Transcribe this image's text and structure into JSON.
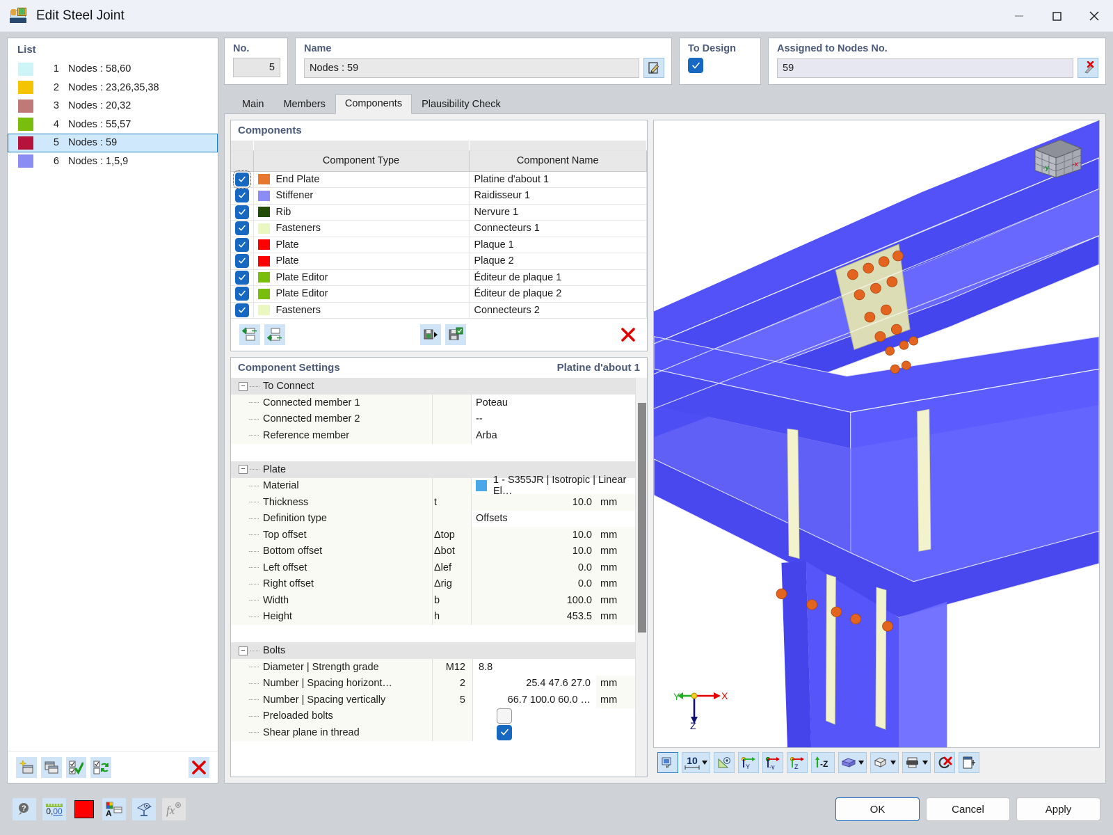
{
  "window": {
    "title": "Edit Steel Joint",
    "icon": "steel-joint-icon",
    "minimize": "minimize-icon",
    "maximize": "maximize-icon",
    "close": "close-icon"
  },
  "list_panel": {
    "title": "List",
    "items": [
      {
        "index": "1",
        "label": "Nodes : 58,60",
        "color": "#cdf4f7"
      },
      {
        "index": "2",
        "label": "Nodes : 23,26,35,38",
        "color": "#f5c400"
      },
      {
        "index": "3",
        "label": "Nodes : 20,32",
        "color": "#c07878"
      },
      {
        "index": "4",
        "label": "Nodes : 55,57",
        "color": "#79bd0d"
      },
      {
        "index": "5",
        "label": "Nodes : 59",
        "color": "#b5123c",
        "selected": true
      },
      {
        "index": "6",
        "label": "Nodes : 1,5,9",
        "color": "#8c8cf5"
      }
    ],
    "toolbar": [
      {
        "name": "new-item-button",
        "icon": "new-window-icon"
      },
      {
        "name": "copy-item-button",
        "icon": "copy-window-icon"
      },
      {
        "name": "select-all-button",
        "icon": "check-all-icon"
      },
      {
        "name": "invert-selection-button",
        "icon": "invert-check-icon"
      },
      {
        "name": "delete-item-button",
        "icon": "red-x-icon"
      }
    ]
  },
  "header": {
    "no": {
      "label": "No.",
      "value": "5"
    },
    "name": {
      "label": "Name",
      "value": "Nodes : 59",
      "edit_icon": "pencil-edit-icon"
    },
    "to_design": {
      "label": "To Design",
      "checked": true
    },
    "assigned": {
      "label": "Assigned to Nodes No.",
      "value": "59",
      "pick_icon": "pick-delete-icon"
    }
  },
  "tabs": [
    {
      "label": "Main",
      "active": false
    },
    {
      "label": "Members",
      "active": false
    },
    {
      "label": "Components",
      "active": true
    },
    {
      "label": "Plausibility Check",
      "active": false
    }
  ],
  "components_panel": {
    "title": "Components",
    "columns": [
      "Component Type",
      "Component Name"
    ],
    "rows": [
      {
        "checked": true,
        "focused": true,
        "color": "#e8762c",
        "type": "End Plate",
        "name": "Platine d'about 1"
      },
      {
        "checked": true,
        "color": "#8c8cf5",
        "type": "Stiffener",
        "name": "Raidisseur 1"
      },
      {
        "checked": true,
        "color": "#234d07",
        "type": "Rib",
        "name": "Nervure 1"
      },
      {
        "checked": true,
        "color": "#eaf7c0",
        "type": "Fasteners",
        "name": "Connecteurs 1"
      },
      {
        "checked": true,
        "color": "#fe0000",
        "type": "Plate",
        "name": "Plaque 1"
      },
      {
        "checked": true,
        "color": "#fe0000",
        "type": "Plate",
        "name": "Plaque 2"
      },
      {
        "checked": true,
        "color": "#79bd0d",
        "type": "Plate Editor",
        "name": "Éditeur de plaque 1"
      },
      {
        "checked": true,
        "color": "#79bd0d",
        "type": "Plate Editor",
        "name": "Éditeur de plaque 2"
      },
      {
        "checked": true,
        "color": "#eaf7c0",
        "type": "Fasteners",
        "name": "Connecteurs 2"
      }
    ],
    "toolbar": [
      {
        "name": "move-component-up-button",
        "icon": "insert-before-icon"
      },
      {
        "name": "move-component-down-button",
        "icon": "insert-after-icon"
      },
      {
        "name": "import-component-button",
        "icon": "import-green-icon"
      },
      {
        "name": "save-component-button",
        "icon": "save-green-icon"
      },
      {
        "name": "delete-component-button",
        "icon": "red-x-icon"
      }
    ]
  },
  "settings_panel": {
    "title": "Component Settings",
    "subject": "Platine d'about 1",
    "groups": [
      {
        "name": "To Connect",
        "expanded": true,
        "rows": [
          {
            "label": "Connected member 1",
            "symbol": "",
            "value": "Poteau",
            "unit": ""
          },
          {
            "label": "Connected member 2",
            "symbol": "",
            "value": "--",
            "unit": ""
          },
          {
            "label": "Reference member",
            "symbol": "",
            "value": "Arba",
            "unit": ""
          }
        ]
      },
      {
        "name": "Plate",
        "expanded": true,
        "rows": [
          {
            "label": "Material",
            "symbol": "",
            "value": "1 - S355JR | Isotropic | Linear El…",
            "unit": "",
            "swatch": "#4aa8e8"
          },
          {
            "label": "Thickness",
            "symbol": "t",
            "value": "10.0",
            "unit": "mm",
            "numeric": true
          },
          {
            "label": "Definition type",
            "symbol": "",
            "value": "Offsets",
            "unit": ""
          },
          {
            "label": "Top offset",
            "symbol": "Δtop",
            "value": "10.0",
            "unit": "mm",
            "numeric": true
          },
          {
            "label": "Bottom offset",
            "symbol": "Δbot",
            "value": "10.0",
            "unit": "mm",
            "numeric": true
          },
          {
            "label": "Left offset",
            "symbol": "Δlef",
            "value": "0.0",
            "unit": "mm",
            "numeric": true
          },
          {
            "label": "Right offset",
            "symbol": "Δrig",
            "value": "0.0",
            "unit": "mm",
            "numeric": true
          },
          {
            "label": "Width",
            "symbol": "b",
            "value": "100.0",
            "unit": "mm",
            "numeric": true
          },
          {
            "label": "Height",
            "symbol": "h",
            "value": "453.5",
            "unit": "mm",
            "numeric": true
          }
        ]
      },
      {
        "name": "Bolts",
        "expanded": true,
        "rows": [
          {
            "label": "Diameter | Strength grade",
            "col1": "M12",
            "value": "8.8",
            "unit": "",
            "leftalign": true
          },
          {
            "label": "Number | Spacing horizont…",
            "col1": "2",
            "value": "25.4 47.6 27.0",
            "unit": "mm"
          },
          {
            "label": "Number | Spacing vertically",
            "col1": "5",
            "value": "66.7 100.0 60.0 …",
            "unit": "mm"
          },
          {
            "label": "Preloaded bolts",
            "checkbox": false
          },
          {
            "label": "Shear plane in thread",
            "checkbox": true
          }
        ]
      }
    ]
  },
  "viewport": {
    "axis": {
      "x": "X",
      "y": "Y",
      "z": "Z"
    },
    "cube": {
      "face_left": "-y",
      "face_right": "-x"
    },
    "toolbar": [
      {
        "name": "render-mode-button",
        "icon": "render-image-icon",
        "selected": true
      },
      {
        "name": "zoom-factor-select",
        "icon": "ruler-icon",
        "value": "10",
        "dropdown": true
      },
      {
        "name": "measure-button",
        "icon": "measure-angle-icon"
      },
      {
        "name": "view-in-y-button",
        "icon": "axis-y-icon",
        "label": "Y"
      },
      {
        "name": "view-in-minus-y-button",
        "icon": "axis-minus-y-icon",
        "label": "-Y"
      },
      {
        "name": "view-in-z-button",
        "icon": "axis-z-icon",
        "label": "Z"
      },
      {
        "name": "view-in-minus-z-button",
        "icon": "axis-minus-z-icon",
        "label": "-Z"
      },
      {
        "name": "display-style-button",
        "icon": "solid-block-icon",
        "dropdown": true
      },
      {
        "name": "view-box-button",
        "icon": "wireframe-cube-icon",
        "dropdown": true
      },
      {
        "name": "print-button",
        "icon": "printer-icon",
        "dropdown": true
      },
      {
        "name": "clear-selection-button",
        "icon": "deselect-icon"
      },
      {
        "name": "detach-view-button",
        "icon": "detach-panel-icon"
      }
    ]
  },
  "bottom_bar": {
    "tools": [
      {
        "name": "help-button",
        "icon": "help-magnifier-icon"
      },
      {
        "name": "decimal-places-button",
        "icon": "decimal-places-icon",
        "label": "0,00"
      },
      {
        "name": "color-button",
        "icon": "color-swatch-icon",
        "color": "#fe0000"
      },
      {
        "name": "display-properties-button",
        "icon": "display-properties-icon"
      },
      {
        "name": "visibility-button",
        "icon": "visibility-icon"
      },
      {
        "name": "formula-button",
        "icon": "formula-fx-icon",
        "label": "fx",
        "disabled": true
      }
    ],
    "buttons": [
      {
        "name": "ok-button",
        "label": "OK",
        "primary": true
      },
      {
        "name": "cancel-button",
        "label": "Cancel"
      },
      {
        "name": "apply-button",
        "label": "Apply"
      }
    ]
  }
}
